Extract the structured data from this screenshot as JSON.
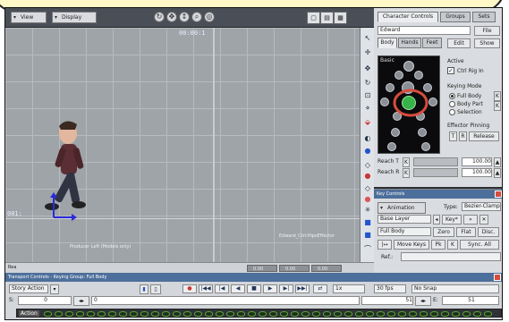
{
  "viewer": {
    "view_menu": "View",
    "display_menu": "Display",
    "frame_counter": "00:00:1",
    "marker_left": "001:",
    "camera_label": "Producer Left (Models only)",
    "effector_label": "Edward_Ctrl:HipsEffector",
    "status_text": "Rea",
    "status_values": [
      "0.00",
      "0.00",
      "0.00"
    ]
  },
  "character_panel": {
    "tabs": [
      "Character Controls",
      "Groups",
      "Sets"
    ],
    "character_name": "Edward",
    "file_label": "File",
    "subtabs": [
      "Body",
      "Hands",
      "Feet"
    ],
    "edit_label": "Edit",
    "show_label": "Show",
    "basic_label": "Basic",
    "active_title": "Active",
    "ctrl_rig_in": "Ctrl Rig In",
    "keying_mode_title": "Keying Mode",
    "keying_modes": [
      "Full Body",
      "Body Part",
      "Selection"
    ],
    "effector_pinning": "Effector Pinning",
    "pin_t": "T",
    "pin_r": "R",
    "release": "Release",
    "reach_t_label": "Reach T",
    "reach_r_label": "Reach R",
    "reach_t_value": "100.00",
    "reach_r_value": "100.00"
  },
  "key_controls": {
    "title": "Key Controls",
    "animation_label": "Animation",
    "type_label": "Type:",
    "type_value": "Bezier-Clamp",
    "base_layer": "Base Layer",
    "key_label": "Key*",
    "full_body": "Full Body",
    "zero": "Zero",
    "flat": "Flat",
    "disc": "Disc.",
    "move_keys": "Move Keys",
    "pk": "Pk",
    "sync_all": "Sync. All",
    "ref_label": "Ref.:"
  },
  "transport": {
    "title": "Transport Controls - Keying Group: Full Body",
    "story_action": "Story Action",
    "speed": "1x",
    "fps": "30 fps",
    "snap": "No Snap",
    "start_label": "S:",
    "start_value": "0",
    "current_frame": "0",
    "end_left": "51",
    "end_label": "E:",
    "end_value": "51",
    "timeline_label": "Action"
  },
  "colors": {
    "accent_red": "#d74c3c",
    "highlight_green": "#38b34a",
    "header_blue": "#4d6f9b"
  }
}
